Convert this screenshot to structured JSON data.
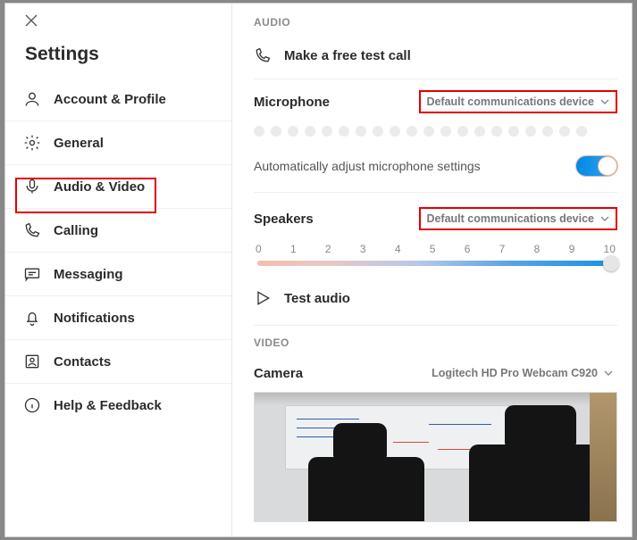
{
  "window": {
    "title": "Settings"
  },
  "sidebar": {
    "items": [
      {
        "label": "Account & Profile"
      },
      {
        "label": "General"
      },
      {
        "label": "Audio & Video"
      },
      {
        "label": "Calling"
      },
      {
        "label": "Messaging"
      },
      {
        "label": "Notifications"
      },
      {
        "label": "Contacts"
      },
      {
        "label": "Help & Feedback"
      }
    ],
    "selected_index": 2
  },
  "audio": {
    "section_label": "AUDIO",
    "test_call_label": "Make a free test call",
    "microphone": {
      "label": "Microphone",
      "selected": "Default communications device",
      "level_dots": 20
    },
    "auto_adjust": {
      "label": "Automatically adjust microphone settings",
      "value": true
    },
    "speakers": {
      "label": "Speakers",
      "selected": "Default communications device",
      "scale_min": 0,
      "scale_max": 10,
      "value": 10
    },
    "test_audio_label": "Test audio"
  },
  "video": {
    "section_label": "VIDEO",
    "camera": {
      "label": "Camera",
      "selected": "Logitech HD Pro Webcam C920"
    }
  }
}
